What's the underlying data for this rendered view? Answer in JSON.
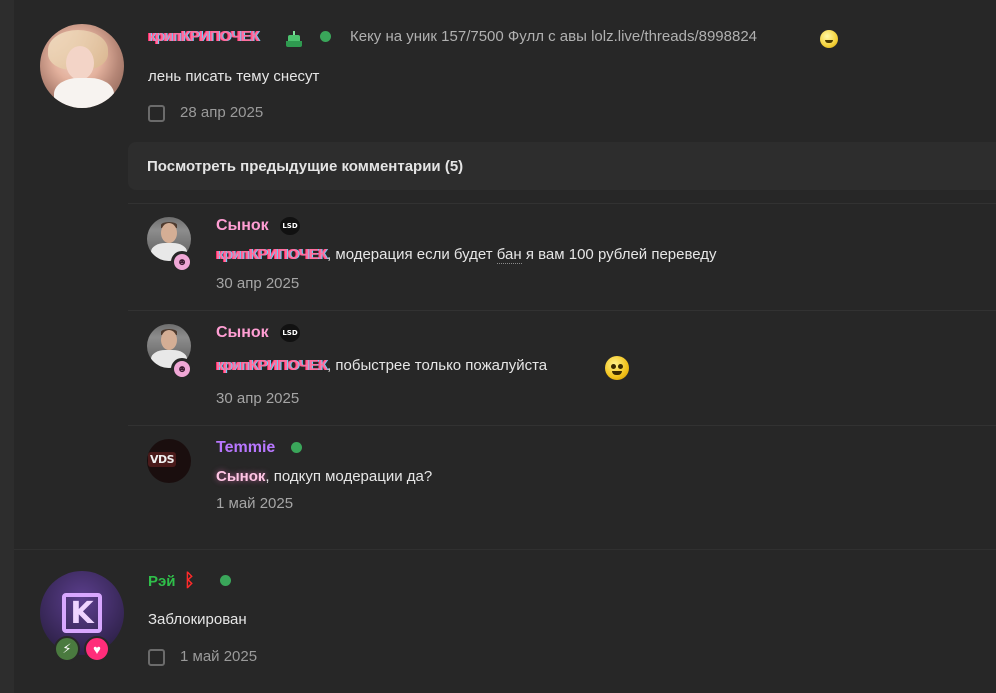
{
  "post1": {
    "username": "крипКРИПОЧЕК",
    "status": "Кеку на уник 157/7500 Фулл с авы lolz.live/threads/8998824",
    "message": "лень писать тему снесут",
    "date": "28 апр 2025",
    "prev_comments_label": "Посмотреть предыдущие комментарии (5)",
    "comments": [
      {
        "author": "Сынок",
        "badge": "LSD",
        "mention": "крипКРИПОЧЕК",
        "text_before": ", модерация если будет ",
        "underlined": "бан",
        "text_after": " я вам 100 рублей переведу",
        "date": "30 апр 2025"
      },
      {
        "author": "Сынок",
        "badge": "LSD",
        "mention": "крипКРИПОЧЕК",
        "text": ", побыстрее только пожалуйста",
        "date": "30 апр 2025"
      },
      {
        "author": "Temmie",
        "avatar_text": "VDS",
        "mention": "Сынок",
        "text": ", подкуп модерации да?",
        "date": "1 май 2025"
      }
    ]
  },
  "post2": {
    "username": "Рэй",
    "rune": "ᛒ",
    "message": "Заблокирован",
    "date": "1 май 2025",
    "avatar_letter": "K"
  },
  "colors": {
    "background": "#272727",
    "online": "#3aa65a",
    "name_green": "#2fbf4a",
    "name_purple": "#b877ff",
    "name_pink": "#ff9ed3"
  }
}
